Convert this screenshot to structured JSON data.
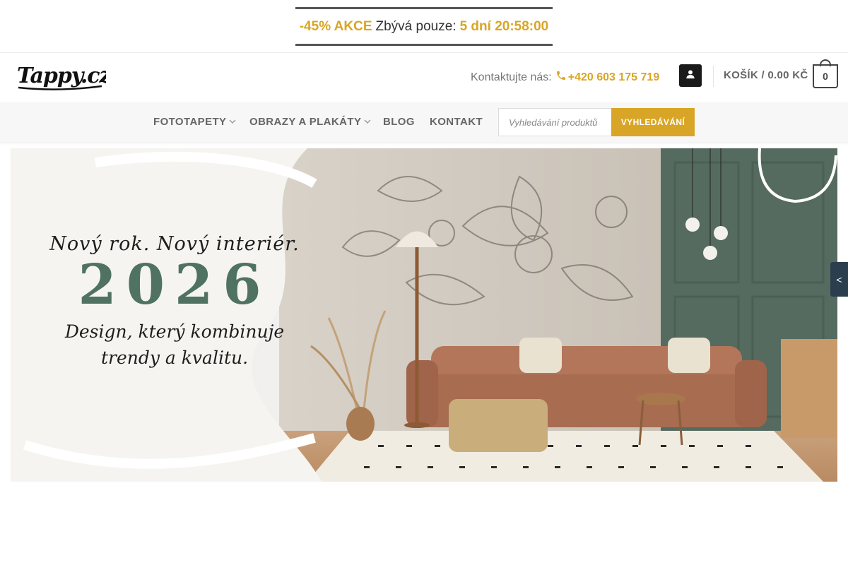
{
  "promo": {
    "discount": "-45% AKCE",
    "remaining_label": "Zbývá pouze:",
    "countdown": "5 dní 20:58:00"
  },
  "header": {
    "logo_text": "Tappy.cz",
    "contact_label": "Kontaktujte nás:",
    "phone": "+420 603 175 719",
    "cart_label": "KOŠÍK / 0.00 KČ",
    "cart_count": "0"
  },
  "nav": {
    "items": [
      {
        "label": "FOTOTAPETY",
        "has_dropdown": true
      },
      {
        "label": "OBRAZY A PLAKÁTY",
        "has_dropdown": true
      },
      {
        "label": "BLOG",
        "has_dropdown": false
      },
      {
        "label": "KONTAKT",
        "has_dropdown": false
      }
    ],
    "search_placeholder": "Vyhledávání produktů",
    "search_button": "VYHLEDÁVÁNÍ"
  },
  "hero": {
    "line1": "Nový rok. Nový interiér.",
    "year": "2026",
    "line2": "Design, který kombinuje",
    "line3": "trendy a kvalitu."
  },
  "side_tab": {
    "label": "<"
  },
  "colors": {
    "accent": "#d9a526",
    "dark": "#1a1a1a",
    "year_green": "#4f7262",
    "side_tab": "#2b3e4e"
  }
}
